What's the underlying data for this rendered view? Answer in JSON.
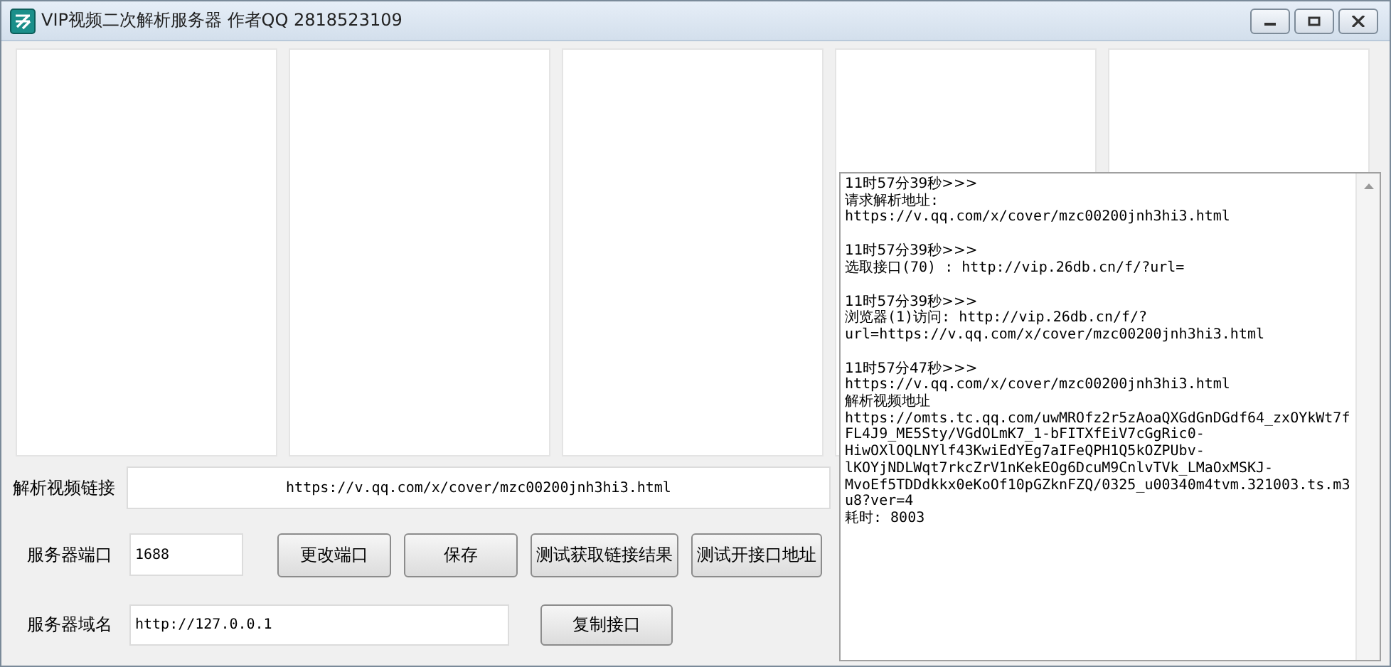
{
  "window": {
    "title": "VIP视频二次解析服务器 作者QQ 2818523109"
  },
  "log": {
    "entries": [
      {
        "time": "11时57分39秒>>>",
        "lines": [
          "请求解析地址:",
          "https://v.qq.com/x/cover/mzc00200jnh3hi3.html"
        ]
      },
      {
        "time": "11时57分39秒>>>",
        "lines": [
          "选取接口(70) : http://vip.26db.cn/f/?url="
        ]
      },
      {
        "time": "11时57分39秒>>>",
        "lines": [
          "浏览器(1)访问: http://vip.26db.cn/f/?",
          "url=https://v.qq.com/x/cover/mzc00200jnh3hi3.html"
        ]
      },
      {
        "time": "11时57分47秒>>>",
        "lines": [
          "https://v.qq.com/x/cover/mzc00200jnh3hi3.html",
          "解析视频地址",
          "https://omts.tc.qq.com/uwMROfz2r5zAoaQXGdGnDGdf64_zxOYkWt7f",
          "FL4J9_ME5Sty/VGdOLmK7_1-bFITXfEiV7cGgRic0-",
          "HiwOXlOQLNYlf43KwiEdYEg7aIFeQPH1Q5kOZPUbv-",
          "lKOYjNDLWqt7rkcZrV1nKekEOg6DcuM9CnlvTVk_LMaOxMSKJ-",
          "MvoEf5TDDdkkx0eKoOf10pGZknFZQ/0325_u00340m4tvm.321003.ts.m3",
          "u8?ver=4",
          "耗时: 8003"
        ]
      }
    ]
  },
  "link": {
    "label": "解析视频链接",
    "value": "https://v.qq.com/x/cover/mzc00200jnh3hi3.html"
  },
  "port": {
    "label": "服务器端口",
    "value": "1688"
  },
  "port_buttons": [
    "更改端口",
    "保存",
    "测试获取链接结果",
    "测试开接口地址"
  ],
  "domain": {
    "label": "服务器域名",
    "value": "http://127.0.0.1"
  },
  "domain_buttons": [
    "复制接口"
  ]
}
